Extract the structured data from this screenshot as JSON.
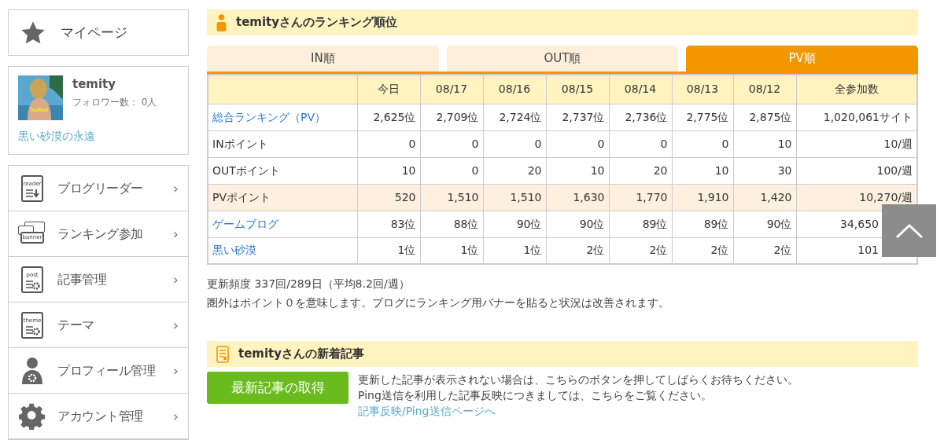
{
  "sidebar": {
    "mypage": {
      "label": "マイページ"
    },
    "profile": {
      "name": "temity",
      "followers": "フォロワー数： 0人",
      "blog_link": "黒い砂漠の永遠"
    },
    "menu": [
      {
        "kind": "reader",
        "icon_text": "reader",
        "label": "ブログリーダー",
        "chevron": "›"
      },
      {
        "kind": "banner",
        "icon_text": "banner",
        "label": "ランキング参加",
        "chevron": "›"
      },
      {
        "kind": "doc",
        "icon_text": "post",
        "label": "記事管理",
        "chevron": "›"
      },
      {
        "kind": "doc",
        "icon_text": "theme",
        "label": "テーマ",
        "chevron": "›"
      },
      {
        "kind": "person",
        "label": "プロフィール管理",
        "chevron": "›"
      },
      {
        "kind": "gear",
        "label": "アカウント管理",
        "chevron": "›"
      }
    ]
  },
  "ranking": {
    "title": "temityさんのランキング順位",
    "tabs": [
      {
        "label": "IN順",
        "selected": false
      },
      {
        "label": "OUT順",
        "selected": false
      },
      {
        "label": "PV順",
        "selected": true
      }
    ],
    "table": {
      "columns": [
        "今日",
        "08/17",
        "08/16",
        "08/15",
        "08/14",
        "08/13",
        "08/12",
        "全参加数"
      ],
      "rows": [
        {
          "label": "総合ランキング（PV）",
          "link": true,
          "highlight": false,
          "cells": [
            "2,625位",
            "2,709位",
            "2,724位",
            "2,737位",
            "2,736位",
            "2,775位",
            "2,875位",
            "1,020,061サイト"
          ]
        },
        {
          "label": "INポイント",
          "link": false,
          "highlight": false,
          "cells": [
            "0",
            "0",
            "0",
            "0",
            "0",
            "0",
            "10",
            "10/週"
          ]
        },
        {
          "label": "OUTポイント",
          "link": false,
          "highlight": false,
          "cells": [
            "10",
            "0",
            "20",
            "10",
            "20",
            "10",
            "30",
            "100/週"
          ]
        },
        {
          "label": "PVポイント",
          "link": false,
          "highlight": true,
          "cells": [
            "520",
            "1,510",
            "1,510",
            "1,630",
            "1,770",
            "1,910",
            "1,420",
            "10,270/週"
          ]
        },
        {
          "label": "ゲームブログ",
          "link": true,
          "highlight": false,
          "cells": [
            "83位",
            "88位",
            "90位",
            "90位",
            "89位",
            "89位",
            "90位",
            "34,650"
          ]
        },
        {
          "label": "黒い砂漠",
          "link": true,
          "highlight": false,
          "cells": [
            "1位",
            "1位",
            "1位",
            "2位",
            "2位",
            "2位",
            "2位",
            "101"
          ]
        }
      ]
    },
    "notes": [
      "更新頻度 337回/289日（平均8.2回/週）",
      "圏外はポイント０を意味します。ブログにランキング用バナーを貼ると状況は改善されます。"
    ]
  },
  "articles": {
    "title": "temityさんの新着記事",
    "button": "最新記事の取得",
    "text_1": "更新した記事が表示されない場合は、こちらのボタンを押してしばらくお待ちください。",
    "text_2": "Ping送信を利用した記事反映につきましては、こちらをご覧ください。",
    "link": "記事反映/Ping送信ページへ"
  }
}
